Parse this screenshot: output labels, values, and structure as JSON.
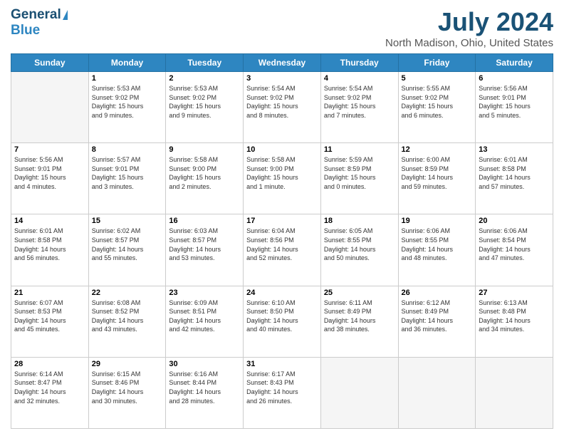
{
  "header": {
    "logo_line1": "General",
    "logo_line2": "Blue",
    "month": "July 2024",
    "location": "North Madison, Ohio, United States"
  },
  "days_of_week": [
    "Sunday",
    "Monday",
    "Tuesday",
    "Wednesday",
    "Thursday",
    "Friday",
    "Saturday"
  ],
  "weeks": [
    [
      {
        "day": "",
        "info": ""
      },
      {
        "day": "1",
        "info": "Sunrise: 5:53 AM\nSunset: 9:02 PM\nDaylight: 15 hours\nand 9 minutes."
      },
      {
        "day": "2",
        "info": "Sunrise: 5:53 AM\nSunset: 9:02 PM\nDaylight: 15 hours\nand 9 minutes."
      },
      {
        "day": "3",
        "info": "Sunrise: 5:54 AM\nSunset: 9:02 PM\nDaylight: 15 hours\nand 8 minutes."
      },
      {
        "day": "4",
        "info": "Sunrise: 5:54 AM\nSunset: 9:02 PM\nDaylight: 15 hours\nand 7 minutes."
      },
      {
        "day": "5",
        "info": "Sunrise: 5:55 AM\nSunset: 9:02 PM\nDaylight: 15 hours\nand 6 minutes."
      },
      {
        "day": "6",
        "info": "Sunrise: 5:56 AM\nSunset: 9:01 PM\nDaylight: 15 hours\nand 5 minutes."
      }
    ],
    [
      {
        "day": "7",
        "info": "Sunrise: 5:56 AM\nSunset: 9:01 PM\nDaylight: 15 hours\nand 4 minutes."
      },
      {
        "day": "8",
        "info": "Sunrise: 5:57 AM\nSunset: 9:01 PM\nDaylight: 15 hours\nand 3 minutes."
      },
      {
        "day": "9",
        "info": "Sunrise: 5:58 AM\nSunset: 9:00 PM\nDaylight: 15 hours\nand 2 minutes."
      },
      {
        "day": "10",
        "info": "Sunrise: 5:58 AM\nSunset: 9:00 PM\nDaylight: 15 hours\nand 1 minute."
      },
      {
        "day": "11",
        "info": "Sunrise: 5:59 AM\nSunset: 8:59 PM\nDaylight: 15 hours\nand 0 minutes."
      },
      {
        "day": "12",
        "info": "Sunrise: 6:00 AM\nSunset: 8:59 PM\nDaylight: 14 hours\nand 59 minutes."
      },
      {
        "day": "13",
        "info": "Sunrise: 6:01 AM\nSunset: 8:58 PM\nDaylight: 14 hours\nand 57 minutes."
      }
    ],
    [
      {
        "day": "14",
        "info": "Sunrise: 6:01 AM\nSunset: 8:58 PM\nDaylight: 14 hours\nand 56 minutes."
      },
      {
        "day": "15",
        "info": "Sunrise: 6:02 AM\nSunset: 8:57 PM\nDaylight: 14 hours\nand 55 minutes."
      },
      {
        "day": "16",
        "info": "Sunrise: 6:03 AM\nSunset: 8:57 PM\nDaylight: 14 hours\nand 53 minutes."
      },
      {
        "day": "17",
        "info": "Sunrise: 6:04 AM\nSunset: 8:56 PM\nDaylight: 14 hours\nand 52 minutes."
      },
      {
        "day": "18",
        "info": "Sunrise: 6:05 AM\nSunset: 8:55 PM\nDaylight: 14 hours\nand 50 minutes."
      },
      {
        "day": "19",
        "info": "Sunrise: 6:06 AM\nSunset: 8:55 PM\nDaylight: 14 hours\nand 48 minutes."
      },
      {
        "day": "20",
        "info": "Sunrise: 6:06 AM\nSunset: 8:54 PM\nDaylight: 14 hours\nand 47 minutes."
      }
    ],
    [
      {
        "day": "21",
        "info": "Sunrise: 6:07 AM\nSunset: 8:53 PM\nDaylight: 14 hours\nand 45 minutes."
      },
      {
        "day": "22",
        "info": "Sunrise: 6:08 AM\nSunset: 8:52 PM\nDaylight: 14 hours\nand 43 minutes."
      },
      {
        "day": "23",
        "info": "Sunrise: 6:09 AM\nSunset: 8:51 PM\nDaylight: 14 hours\nand 42 minutes."
      },
      {
        "day": "24",
        "info": "Sunrise: 6:10 AM\nSunset: 8:50 PM\nDaylight: 14 hours\nand 40 minutes."
      },
      {
        "day": "25",
        "info": "Sunrise: 6:11 AM\nSunset: 8:49 PM\nDaylight: 14 hours\nand 38 minutes."
      },
      {
        "day": "26",
        "info": "Sunrise: 6:12 AM\nSunset: 8:49 PM\nDaylight: 14 hours\nand 36 minutes."
      },
      {
        "day": "27",
        "info": "Sunrise: 6:13 AM\nSunset: 8:48 PM\nDaylight: 14 hours\nand 34 minutes."
      }
    ],
    [
      {
        "day": "28",
        "info": "Sunrise: 6:14 AM\nSunset: 8:47 PM\nDaylight: 14 hours\nand 32 minutes."
      },
      {
        "day": "29",
        "info": "Sunrise: 6:15 AM\nSunset: 8:46 PM\nDaylight: 14 hours\nand 30 minutes."
      },
      {
        "day": "30",
        "info": "Sunrise: 6:16 AM\nSunset: 8:44 PM\nDaylight: 14 hours\nand 28 minutes."
      },
      {
        "day": "31",
        "info": "Sunrise: 6:17 AM\nSunset: 8:43 PM\nDaylight: 14 hours\nand 26 minutes."
      },
      {
        "day": "",
        "info": ""
      },
      {
        "day": "",
        "info": ""
      },
      {
        "day": "",
        "info": ""
      }
    ]
  ]
}
